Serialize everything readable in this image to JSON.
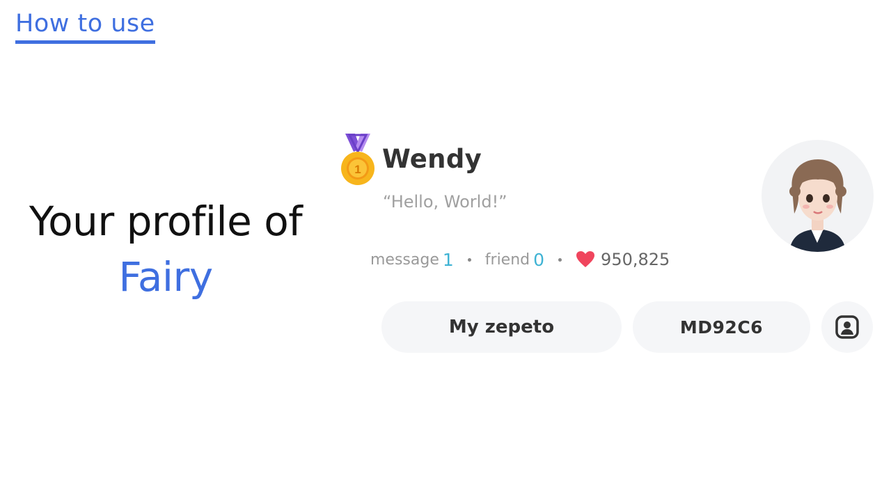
{
  "header": {
    "link_label": "How to use"
  },
  "headline": {
    "line1": "Your profile of",
    "line2": "Fairy"
  },
  "profile": {
    "name": "Wendy",
    "status_message": "“Hello, World!”",
    "rank_badge": "1",
    "stats": {
      "message_label": "message",
      "message_count": "1",
      "friend_label": "friend",
      "friend_count": "0",
      "likes": "950,825"
    },
    "buttons": {
      "my_zepeto": "My zepeto",
      "code": "MD92C6",
      "qr_icon": "profile-scan-icon"
    }
  },
  "colors": {
    "accent": "#3f6fe0",
    "count": "#3fb3d4",
    "heart": "#f0455d",
    "medal": "#f5a623"
  }
}
